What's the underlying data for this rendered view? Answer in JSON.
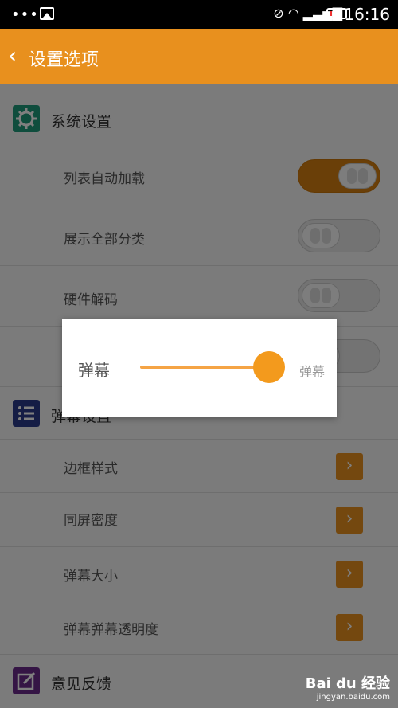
{
  "status_bar": {
    "time": "16:16",
    "icons": [
      "more-dots-icon",
      "image-icon",
      "mute-icon",
      "wifi-icon",
      "signal-icon",
      "battery-icon"
    ]
  },
  "app_bar": {
    "title": "设置选项",
    "back_icon": "chevron-left-icon",
    "color": "#e8901e"
  },
  "sections": {
    "system": {
      "title": "系统设置",
      "icon": "gear-icon",
      "icon_color": "#1f9a7a",
      "items": [
        {
          "label": "列表自动加载",
          "toggle": true
        },
        {
          "label": "展示全部分类",
          "toggle": false
        },
        {
          "label": "硬件解码",
          "toggle": false
        },
        {
          "label": "",
          "toggle": false
        }
      ]
    },
    "danmaku": {
      "title": "弹幕设置",
      "icon": "list-icon",
      "icon_color": "#2a3a8a",
      "items": [
        {
          "label": "边框样式"
        },
        {
          "label": "同屏密度"
        },
        {
          "label": "弹幕大小"
        },
        {
          "label": "弹幕弹幕透明度"
        }
      ]
    },
    "feedback": {
      "title": "意见反馈",
      "icon": "edit-icon",
      "icon_color": "#6a2a8a"
    }
  },
  "dialog": {
    "label": "弹幕",
    "value_label": "弹幕",
    "slider_value": 0.9,
    "accent": "#f39a1d"
  },
  "watermark": {
    "brand": "Bai du 经验",
    "url": "jingyan.baidu.com"
  }
}
